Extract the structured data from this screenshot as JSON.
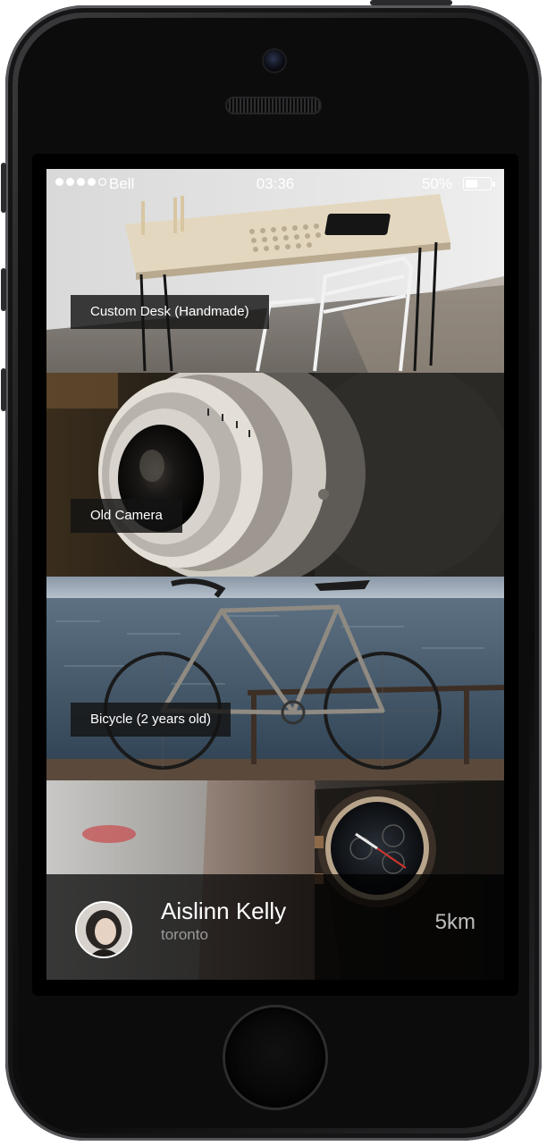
{
  "status_bar": {
    "carrier": "Bell",
    "time": "03:36",
    "battery_percent_label": "50%",
    "battery_level": 0.5,
    "signal_bars": 4,
    "signal_max": 5
  },
  "listings": [
    {
      "label": "Custom Desk (Handmade)"
    },
    {
      "label": "Old Camera"
    },
    {
      "label": "Bicycle (2 years old)"
    },
    {
      "label": ""
    }
  ],
  "profile": {
    "name": "Aislinn Kelly",
    "city": "toronto",
    "distance": "5km"
  },
  "colors": {
    "label_bg": "#141414",
    "text": "#ffffff",
    "muted_text": "#9a9a9a"
  }
}
